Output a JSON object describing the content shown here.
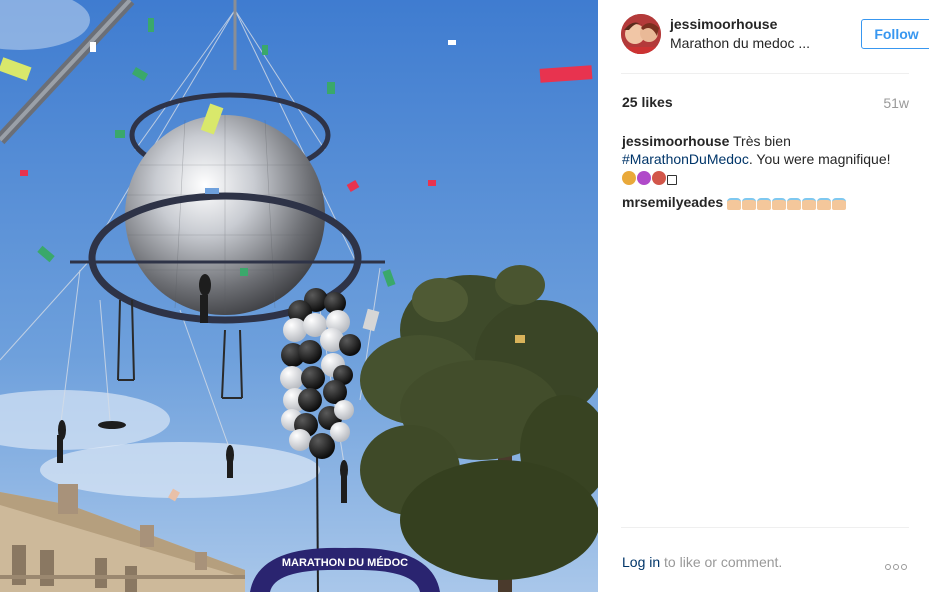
{
  "post": {
    "username": "jessimoorhouse",
    "location": "Marathon du medoc ...",
    "follow_label": "Follow",
    "likes": "25 likes",
    "age": "51w",
    "caption": {
      "user": "jessimoorhouse",
      "text_before": " Très bien",
      "hashtag": "#MarathonDuMedoc",
      "text_after": ". You were magnifique!"
    },
    "comments": [
      {
        "user": "mrsemilyeades"
      }
    ],
    "login_link": "Log in",
    "login_rest": " to like or comment."
  },
  "photo": {
    "arch_text": "MARATHON DU MÉDOC"
  },
  "colors": {
    "accent": "#3897f0",
    "link": "#003569",
    "muted": "#999999",
    "sky": "#4f86cf"
  }
}
